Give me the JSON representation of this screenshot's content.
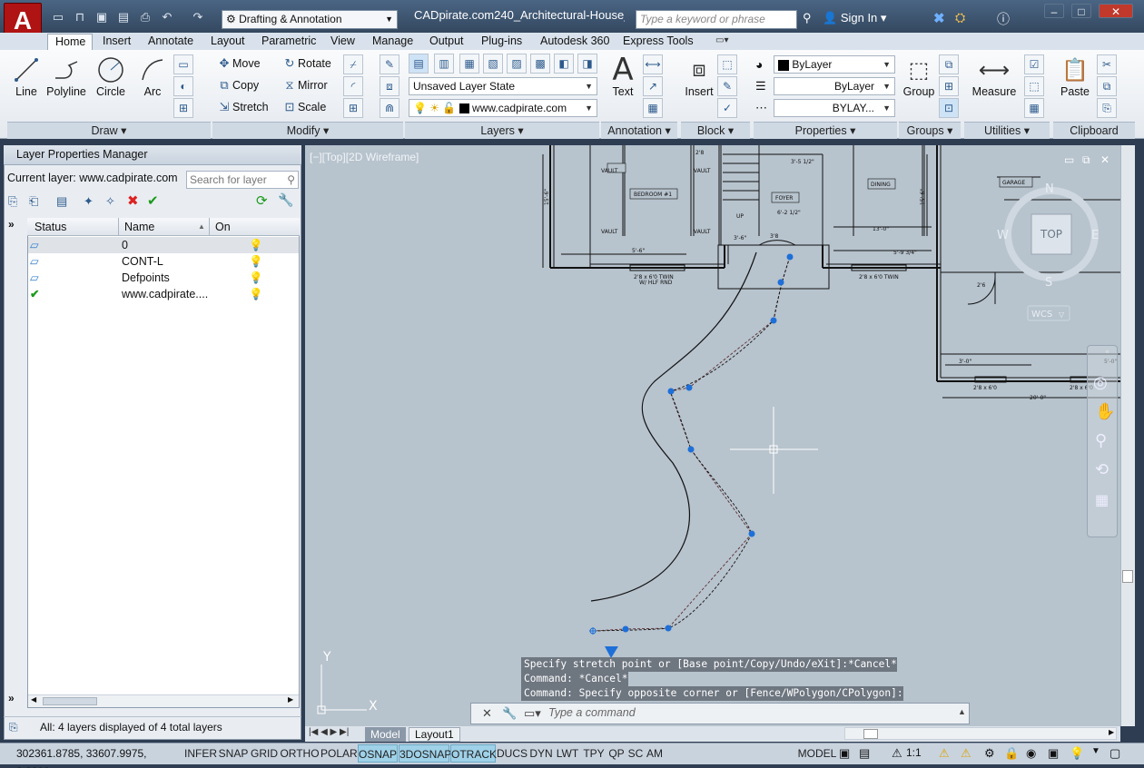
{
  "title": {
    "document": "CADpirate.com240_Architectural-House_...",
    "workspace": "Drafting & Annotation",
    "search_placeholder": "Type a keyword or phrase",
    "sign_in": "Sign In",
    "app_logo": "A"
  },
  "tabs": [
    "Home",
    "Insert",
    "Annotate",
    "Layout",
    "Parametric",
    "View",
    "Manage",
    "Output",
    "Plug-ins",
    "Autodesk 360",
    "Express Tools"
  ],
  "ribbon": {
    "draw": {
      "label": "Draw",
      "line": "Line",
      "polyline": "Polyline",
      "circle": "Circle",
      "arc": "Arc"
    },
    "modify": {
      "label": "Modify",
      "move": "Move",
      "copy": "Copy",
      "stretch": "Stretch",
      "rotate": "Rotate",
      "mirror": "Mirror",
      "scale": "Scale"
    },
    "layers": {
      "label": "Layers",
      "state": "Unsaved Layer State",
      "current": "www.cadpirate.com"
    },
    "annotation": {
      "label": "Annotation",
      "text": "Text"
    },
    "block": {
      "label": "Block",
      "insert": "Insert"
    },
    "properties": {
      "label": "Properties",
      "color": "ByLayer",
      "linetype": "ByLayer",
      "lineweight": "BYLAY..."
    },
    "groups": {
      "label": "Groups",
      "group": "Group"
    },
    "utilities": {
      "label": "Utilities",
      "measure": "Measure"
    },
    "clipboard": {
      "label": "Clipboard",
      "paste": "Paste"
    }
  },
  "layer_panel": {
    "title": "Layer Properties Manager",
    "current_layer": "Current layer: www.cadpirate.com",
    "search_placeholder": "Search for layer",
    "columns": {
      "status": "Status",
      "name": "Name",
      "on": "On"
    },
    "layers": [
      {
        "name": "0",
        "current": false
      },
      {
        "name": "CONT-L",
        "current": false
      },
      {
        "name": "Defpoints",
        "current": false
      },
      {
        "name": "www.cadpirate....",
        "current": true
      }
    ],
    "status": "All: 4 layers displayed of 4 total layers"
  },
  "viewport": {
    "label": "[−][Top][2D Wireframe]",
    "viewcube": {
      "top": "TOP",
      "n": "N",
      "s": "S",
      "e": "E",
      "w": "W",
      "wcs": "WCS"
    },
    "ucs": {
      "x": "X",
      "y": "Y"
    },
    "plan_labels": {
      "vault1": "VAULT",
      "vault2": "VAULT",
      "vault3": "VAULT",
      "vault4": "VAULT",
      "bedroom": "BEDROOM #1",
      "foyer": "FOYER",
      "dining": "DINING",
      "garage": "GARAGE",
      "up": "UP",
      "win1": "2'8 x 6'0 TWIN",
      "win1b": "W/ HLF RND",
      "win2": "2'8 x 6'0 TWIN",
      "win3": "2'8 x 6'0",
      "win4": "2'8 x 6'0",
      "dim1": "15'-6\"",
      "dim2": "13'-0\"",
      "dim3": "20'-0\"",
      "dim4": "5'-9 3/4\"",
      "dim5": "3'-5 1/2\"",
      "dim6": "6'-2 1/2\"",
      "dim7": "3'-6\"",
      "dim8": "5'-6\"",
      "dim9": "3'-0\"",
      "dim10": "5'-0\"",
      "dim11": "15'-6\"",
      "dim12": "2'8",
      "dim13": "3'8",
      "dim14": "2'6"
    }
  },
  "command": {
    "history": [
      "Specify stretch point or [Base point/Copy/Undo/eXit]:*Cancel*",
      "Command: *Cancel*",
      "Command: Specify opposite corner or [Fence/WPolygon/CPolygon]:"
    ],
    "placeholder": "Type a command"
  },
  "layout_tabs": [
    "Model",
    "Layout1"
  ],
  "statusbar": {
    "coords": "302361.8785, 33607.9975, 0.0000",
    "toggles": [
      {
        "label": "INFER",
        "on": false
      },
      {
        "label": "SNAP",
        "on": false
      },
      {
        "label": "GRID",
        "on": false
      },
      {
        "label": "ORTHO",
        "on": false
      },
      {
        "label": "POLAR",
        "on": false
      },
      {
        "label": "OSNAP",
        "on": true
      },
      {
        "label": "3DOSNAP",
        "on": true
      },
      {
        "label": "OTRACK",
        "on": true
      },
      {
        "label": "DUCS",
        "on": false
      },
      {
        "label": "DYN",
        "on": false
      },
      {
        "label": "LWT",
        "on": false
      },
      {
        "label": "TPY",
        "on": false
      },
      {
        "label": "QP",
        "on": false
      },
      {
        "label": "SC",
        "on": false
      },
      {
        "label": "AM",
        "on": false
      }
    ],
    "model": "MODEL",
    "scale": "1:1"
  },
  "colors": {
    "viewport_bg": "#b7c3cd",
    "grip": "#1e6fd8",
    "toggle_on": "#9fd1e8",
    "logo": "#b01313"
  }
}
